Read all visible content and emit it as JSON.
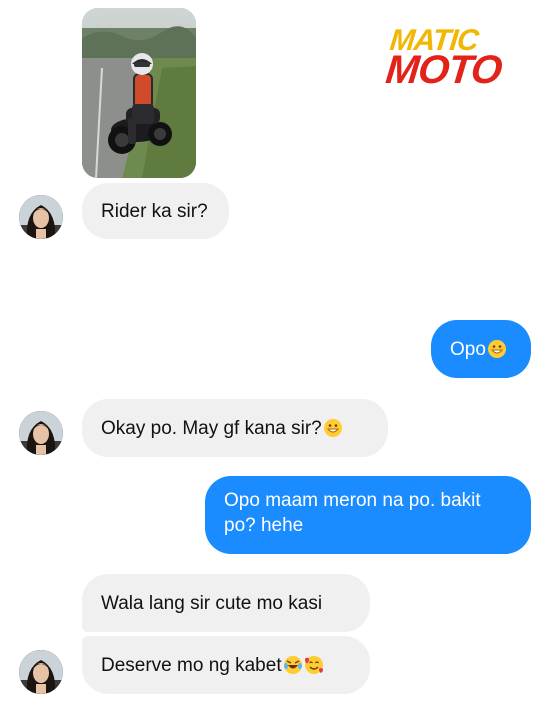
{
  "logo": {
    "line1": "MATIC",
    "line2": "MOTO"
  },
  "messages": [
    {
      "id": "m1",
      "direction": "incoming",
      "type": "photo",
      "description": ""
    },
    {
      "id": "m2",
      "direction": "incoming",
      "text": "Rider ka sir?"
    },
    {
      "id": "m3",
      "direction": "outgoing",
      "text": "Opo",
      "emoji": [
        "grinning-face-icon"
      ]
    },
    {
      "id": "m4",
      "direction": "incoming",
      "text": "Okay po. May gf kana sir?",
      "emoji": [
        "grinning-face-icon"
      ]
    },
    {
      "id": "m5",
      "direction": "outgoing",
      "text": "Opo maam meron na po. bakit po? hehe"
    },
    {
      "id": "m6",
      "direction": "incoming",
      "text": "Wala lang sir cute mo kasi"
    },
    {
      "id": "m7",
      "direction": "incoming",
      "text": "Deserve mo ng kabet",
      "emoji": [
        "tears-of-joy-icon",
        "smiling-face-with-hearts-icon"
      ]
    }
  ],
  "colors": {
    "incoming_bubble": "#f0f0f0",
    "outgoing_bubble": "#1a8cff",
    "logo_yellow": "#f2b705",
    "logo_red": "#e2231a"
  }
}
